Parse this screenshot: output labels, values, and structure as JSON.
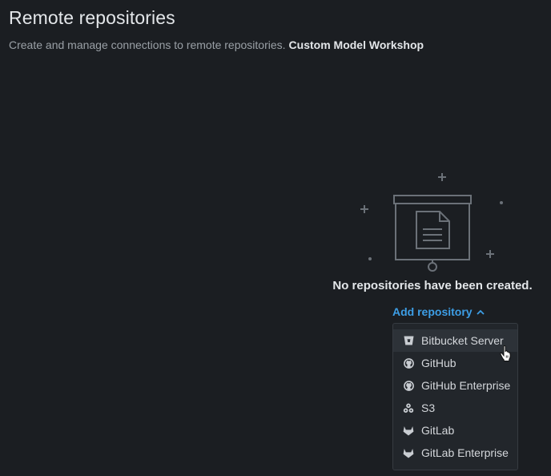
{
  "header": {
    "title": "Remote repositories",
    "subtitle": "Create and manage connections to remote repositories.",
    "subtitle_link": "Custom Model Workshop"
  },
  "empty_state": {
    "message": "No repositories have been created.",
    "illustration_icon": "presentation-board-document-icon"
  },
  "add_repository": {
    "label": "Add repository",
    "icon": "chevron-up-icon",
    "color": "#3d9ee6",
    "menu": [
      {
        "label": "Bitbucket Server",
        "icon": "bitbucket-icon",
        "hovered": true
      },
      {
        "label": "GitHub",
        "icon": "github-icon"
      },
      {
        "label": "GitHub Enterprise",
        "icon": "github-icon"
      },
      {
        "label": "S3",
        "icon": "s3-icon"
      },
      {
        "label": "GitLab",
        "icon": "gitlab-icon"
      },
      {
        "label": "GitLab Enterprise",
        "icon": "gitlab-icon"
      }
    ]
  },
  "colors": {
    "background": "#1b1e22",
    "menu_background": "#22262b",
    "menu_hover": "#2d3238",
    "text_primary": "#e3e6e9",
    "text_secondary": "#9aa0a6"
  }
}
